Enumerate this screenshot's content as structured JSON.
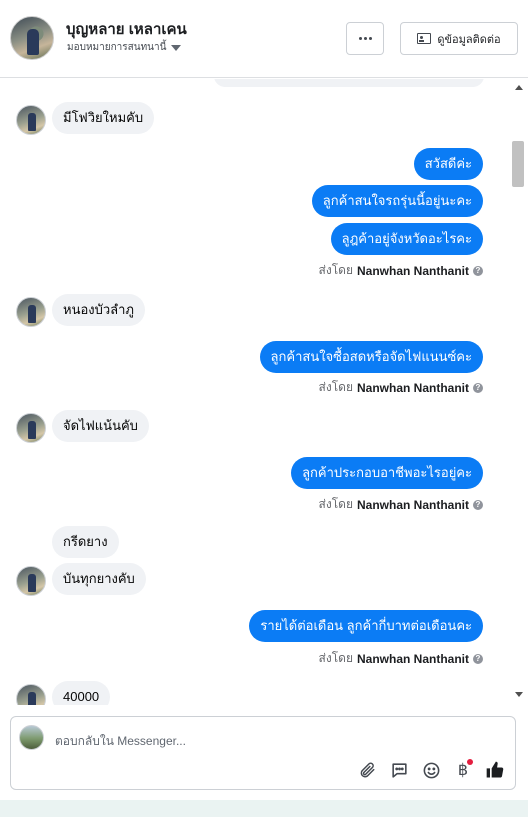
{
  "header": {
    "contact_name": "บุญหลาย เหลาเคน",
    "assign_label": "มอบหมายการสนทนานี้",
    "contact_button_label": "ดูข้อมูลติดต่อ"
  },
  "sent_by_prefix": "ส่งโดย",
  "agent_name": "Nanwhan Nanthanit",
  "messages": [
    {
      "dir": "in",
      "text": "มีโฟวิยใหมคับ"
    },
    {
      "dir": "out",
      "text": "สวัสดีค่ะ"
    },
    {
      "dir": "out",
      "text": "ลูกค้าสนใจรถรุ่นนี้อยู่นะคะ"
    },
    {
      "dir": "out",
      "text": "ลูฎค้าอยู่จังหวัดอะไรคะ"
    },
    {
      "dir": "in",
      "text": "หนองบัวลำภู"
    },
    {
      "dir": "out",
      "text": "ลูกค้าสนใจซื้อสดหรือจัดไฟแนนซ์คะ"
    },
    {
      "dir": "in",
      "text": "จัดไฟแน้นคับ"
    },
    {
      "dir": "out",
      "text": "ลูกค้าประกอบอาชีพอะไรอยู่คะ"
    },
    {
      "dir": "in",
      "text": "กรีดยาง"
    },
    {
      "dir": "in",
      "text": "บันทุกยางคับ"
    },
    {
      "dir": "out",
      "text": "รายได้ต่อเดือน ลูกค้ากี่บาทต่อเดือนคะ"
    },
    {
      "dir": "in",
      "text": "40000"
    }
  ],
  "composer": {
    "placeholder": "ตอบกลับใน Messenger..."
  },
  "colors": {
    "outgoing_bubble": "#0b7cf5",
    "incoming_bubble": "#f0f2f5",
    "like_icon": "#1c1e21",
    "notification_dot": "#e41e3f"
  }
}
